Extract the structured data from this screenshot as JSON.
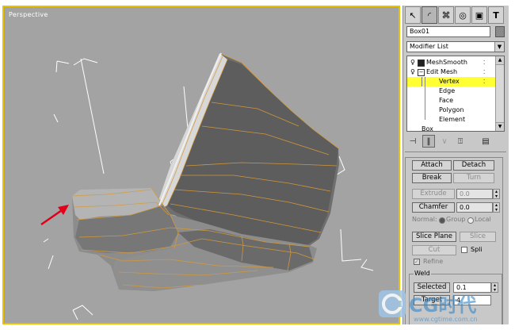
{
  "viewport": {
    "label": "Perspective",
    "bg_color": "#a3a3a3",
    "border_color": "#e8c200"
  },
  "panel": {
    "tabs": [
      {
        "icon": "pointer-arrow-icon",
        "glyph": "↖"
      },
      {
        "icon": "modify-curve-icon",
        "glyph": "◜"
      },
      {
        "icon": "hierarchy-icon",
        "glyph": "⌘"
      },
      {
        "icon": "motion-icon",
        "glyph": "◎"
      },
      {
        "icon": "display-icon",
        "glyph": "▣"
      },
      {
        "icon": "utilities-hammer-icon",
        "glyph": "T"
      }
    ],
    "object_name": "Box01",
    "object_color": "#8a8a8a",
    "modifier_list": "Modifier List",
    "stack": [
      {
        "label": "MeshSmooth",
        "level": 0
      },
      {
        "label": "Edit Mesh",
        "level": 0
      },
      {
        "label": "Vertex",
        "level": 1,
        "selected": true
      },
      {
        "label": "Edge",
        "level": 1
      },
      {
        "label": "Face",
        "level": 1
      },
      {
        "label": "Polygon",
        "level": 1
      },
      {
        "label": "Element",
        "level": 1
      },
      {
        "label": "Box",
        "level": 0
      }
    ],
    "selection_color": "#ffff33",
    "tools": [
      "pin-stack-icon",
      "show-end-result-icon",
      "make-unique-icon",
      "remove-modifier-icon",
      "configure-sets-icon"
    ],
    "edit": {
      "attach": "Attach",
      "detach": "Detach",
      "break": "Break",
      "turn": "Turn",
      "extrude": "Extrude",
      "extrude_value": "0.0",
      "chamfer": "Chamfer",
      "chamfer_value": "0.0",
      "normal_label": "Normal:",
      "group_label": "Group",
      "local_label": "Local",
      "slice_plane": "Slice Plane",
      "slice": "Slice",
      "cut": "Cut",
      "split": "Spli",
      "refine": "Refine",
      "weld_title": "Weld",
      "selected": "Selected",
      "selected_value": "0.1",
      "target": "Target",
      "target_value": "4"
    }
  },
  "watermark": {
    "brand": "CG时代",
    "url": "www.cgtime.com.cn"
  }
}
